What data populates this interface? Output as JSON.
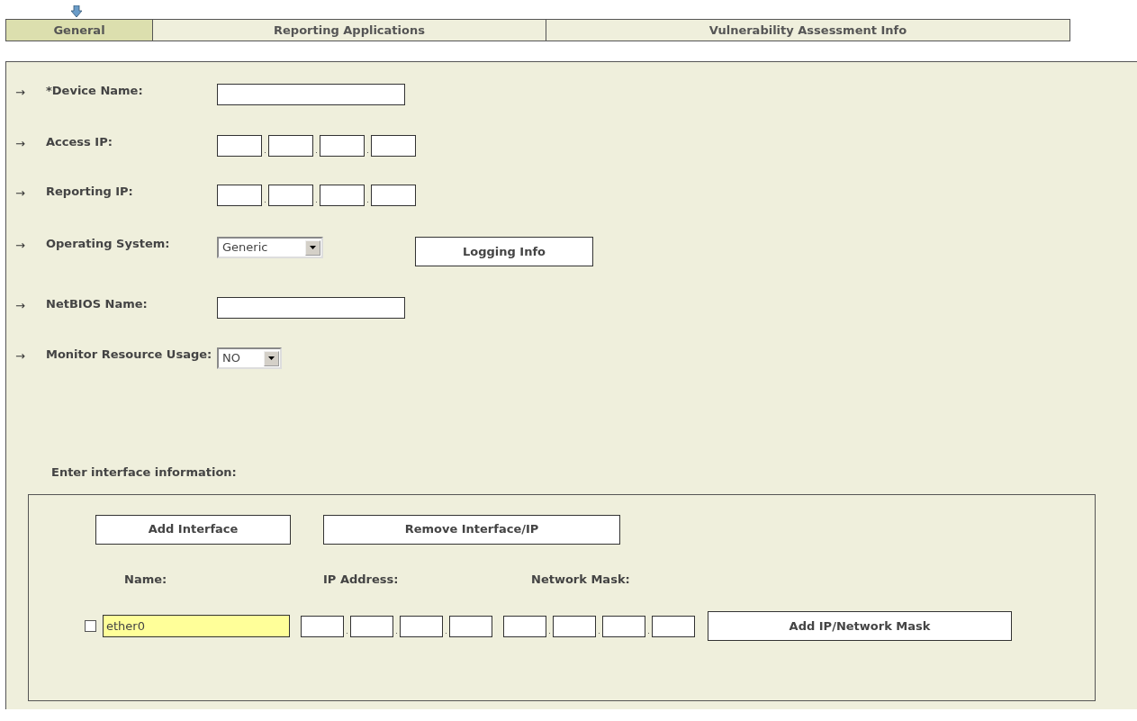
{
  "tabs": [
    {
      "label": "General",
      "selected": true
    },
    {
      "label": "Reporting Applications",
      "selected": false
    },
    {
      "label": "Vulnerability Assessment Info",
      "selected": false
    }
  ],
  "fields": [
    {
      "kind": "text",
      "arrow": "→",
      "label": "*Device Name:"
    },
    {
      "kind": "ip",
      "arrow": "→",
      "label": "Access IP:",
      "separators": [
        ".",
        ".",
        "."
      ]
    },
    {
      "kind": "ip",
      "arrow": "→",
      "label": "Reporting IP:",
      "separators": [
        ".",
        ".",
        "."
      ]
    },
    {
      "kind": "select",
      "arrow": "→",
      "label": "Operating System:",
      "value": "Generic",
      "button": "Logging Info"
    },
    {
      "kind": "text",
      "arrow": "→",
      "label": "NetBIOS Name:"
    },
    {
      "kind": "select",
      "arrow": "→",
      "label": "Monitor Resource Usage:",
      "value": "NO"
    }
  ],
  "interface_section": {
    "heading": "Enter interface information:",
    "buttons": [
      "Add Interface",
      "Remove Interface/IP"
    ],
    "columns": [
      "Name:",
      "IP Address:",
      "Network Mask:"
    ],
    "rows": [
      {
        "checked": false,
        "name": "ether0",
        "ip_separators": [
          ".",
          ".",
          "."
        ],
        "mask_separators": [
          ".",
          ".",
          "."
        ],
        "button": "Add IP/Network Mask"
      }
    ]
  }
}
